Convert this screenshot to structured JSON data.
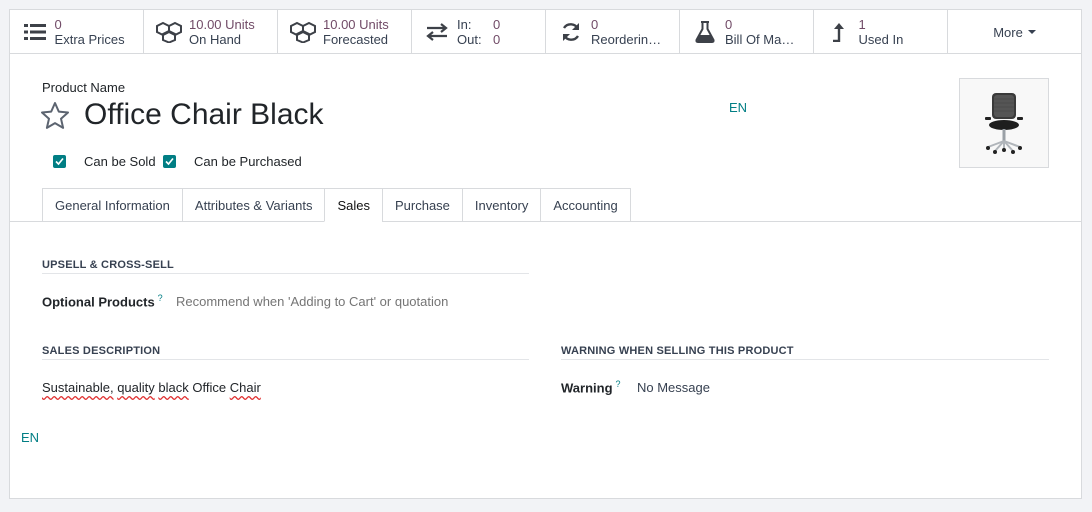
{
  "smart_buttons": {
    "extra_prices": {
      "value": "0",
      "label": "Extra Prices",
      "icon": "list-icon"
    },
    "on_hand": {
      "value": "10.00 Units",
      "label": "On Hand",
      "icon": "cubes-icon"
    },
    "forecasted": {
      "value": "10.00 Units",
      "label": "Forecasted",
      "icon": "cubes-icon"
    },
    "in_out": {
      "in_label": "In:",
      "in_value": "0",
      "out_label": "Out:",
      "out_value": "0",
      "icon": "exchange-icon"
    },
    "reordering": {
      "value": "0",
      "label": "Reordering Rules",
      "icon": "refresh-icon"
    },
    "bom": {
      "value": "0",
      "label": "Bill Of Materials",
      "icon": "flask-icon"
    },
    "used_in": {
      "value": "1",
      "label": "Used In",
      "icon": "level-up-icon"
    },
    "more_label": "More"
  },
  "product": {
    "name_label": "Product Name",
    "name": "Office Chair Black",
    "lang": "EN",
    "can_be_sold_label": "Can be Sold",
    "can_be_sold": true,
    "can_be_purchased_label": "Can be Purchased",
    "can_be_purchased": true
  },
  "tabs": [
    {
      "label": "General Information"
    },
    {
      "label": "Attributes & Variants"
    },
    {
      "label": "Sales",
      "active": true
    },
    {
      "label": "Purchase"
    },
    {
      "label": "Inventory"
    },
    {
      "label": "Accounting"
    }
  ],
  "sales_tab": {
    "upsell_title": "UPSELL & CROSS-SELL",
    "optional_products_label": "Optional Products",
    "optional_products_help": "?",
    "optional_products_placeholder": "Recommend when 'Adding to Cart' or quotation",
    "sales_description_title": "SALES DESCRIPTION",
    "sales_description_words": [
      "Sustainable,",
      "quality",
      "black",
      "Office",
      "Chair"
    ],
    "warning_title": "WARNING WHEN SELLING THIS PRODUCT",
    "warning_label": "Warning",
    "warning_help": "?",
    "warning_value": "No Message",
    "description_lang": "EN"
  },
  "colors": {
    "accent": "#714b67",
    "teal": "#017e84"
  }
}
